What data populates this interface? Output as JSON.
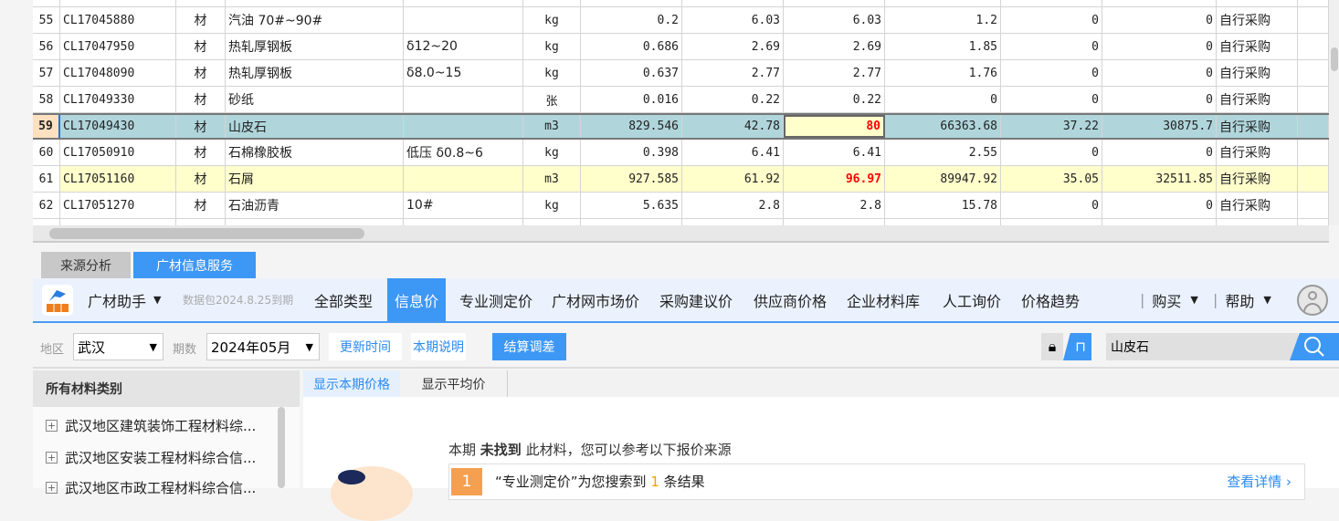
{
  "grid": {
    "rows": [
      {
        "no": "55",
        "code": "CL17045880",
        "type": "材",
        "name": "汽油 70#~90#",
        "spec": "",
        "unit": "kg",
        "qty": "0.2",
        "p1": "6.03",
        "p2": "6.03",
        "amt": "1.2",
        "diff": "0",
        "diffamt": "0",
        "source": "自行采购"
      },
      {
        "no": "56",
        "code": "CL17047950",
        "type": "材",
        "name": "热轧厚钢板",
        "spec": "δ12~20",
        "unit": "kg",
        "qty": "0.686",
        "p1": "2.69",
        "p2": "2.69",
        "amt": "1.85",
        "diff": "0",
        "diffamt": "0",
        "source": "自行采购"
      },
      {
        "no": "57",
        "code": "CL17048090",
        "type": "材",
        "name": "热轧厚钢板",
        "spec": "δ8.0~15",
        "unit": "kg",
        "qty": "0.637",
        "p1": "2.77",
        "p2": "2.77",
        "amt": "1.76",
        "diff": "0",
        "diffamt": "0",
        "source": "自行采购"
      },
      {
        "no": "58",
        "code": "CL17049330",
        "type": "材",
        "name": "砂纸",
        "spec": "",
        "unit": "张",
        "qty": "0.016",
        "p1": "0.22",
        "p2": "0.22",
        "amt": "0",
        "diff": "0",
        "diffamt": "0",
        "source": "自行采购"
      },
      {
        "no": "59",
        "code": "CL17049430",
        "type": "材",
        "name": "山皮石",
        "spec": "",
        "unit": "m3",
        "qty": "829.546",
        "p1": "42.78",
        "p2": "80",
        "amt": "66363.68",
        "diff": "37.22",
        "diffamt": "30875.7",
        "source": "自行采购",
        "state": "selected"
      },
      {
        "no": "60",
        "code": "CL17050910",
        "type": "材",
        "name": "石棉橡胶板",
        "spec": "低压 δ0.8~6",
        "unit": "kg",
        "qty": "0.398",
        "p1": "6.41",
        "p2": "6.41",
        "amt": "2.55",
        "diff": "0",
        "diffamt": "0",
        "source": "自行采购"
      },
      {
        "no": "61",
        "code": "CL17051160",
        "type": "材",
        "name": "石屑",
        "spec": "",
        "unit": "m3",
        "qty": "927.585",
        "p1": "61.92",
        "p2": "96.97",
        "amt": "89947.92",
        "diff": "35.05",
        "diffamt": "32511.85",
        "source": "自行采购",
        "state": "highlight"
      },
      {
        "no": "62",
        "code": "CL17051270",
        "type": "材",
        "name": "石油沥青",
        "spec": "10#",
        "unit": "kg",
        "qty": "5.635",
        "p1": "2.8",
        "p2": "2.8",
        "amt": "15.78",
        "diff": "0",
        "diffamt": "0",
        "source": "自行采购"
      }
    ]
  },
  "tabs": {
    "source": "来源分析",
    "service": "广材信息服务"
  },
  "toolbar": {
    "app": "广材助手",
    "package": "数据包2024.8.25到期",
    "nav": [
      "全部类型",
      "信息价",
      "专业测定价",
      "广材网市场价",
      "采购建议价",
      "供应商价格",
      "企业材料库",
      "人工询价",
      "价格趋势"
    ],
    "active": "信息价",
    "buy": "购买",
    "help": "帮助"
  },
  "filter": {
    "region_label": "地区",
    "region": "武汉",
    "period_label": "期数",
    "period": "2024年05月",
    "update": "更新时间",
    "note": "本期说明",
    "adjust": "结算调差",
    "search": "山皮石"
  },
  "left": {
    "title": "所有材料类别",
    "items": [
      "武汉地区建筑装饰工程材料综...",
      "武汉地区安装工程材料综合信...",
      "武汉地区市政工程材料综合信..."
    ]
  },
  "content": {
    "tabs": [
      "显示本期价格",
      "显示平均价"
    ],
    "msg_pre": "本期",
    "msg_bold": "未找到",
    "msg_post": "此材料，您可以参考以下报价来源",
    "result_no": "1",
    "result_pre": "“专业测定价”为您搜索到",
    "result_count": "1",
    "result_post": "条结果",
    "detail": "查看详情 ›"
  },
  "colors": {
    "accent": "#3d97f5",
    "selected": "#b0d6dc",
    "highlight": "#ffffcc"
  }
}
